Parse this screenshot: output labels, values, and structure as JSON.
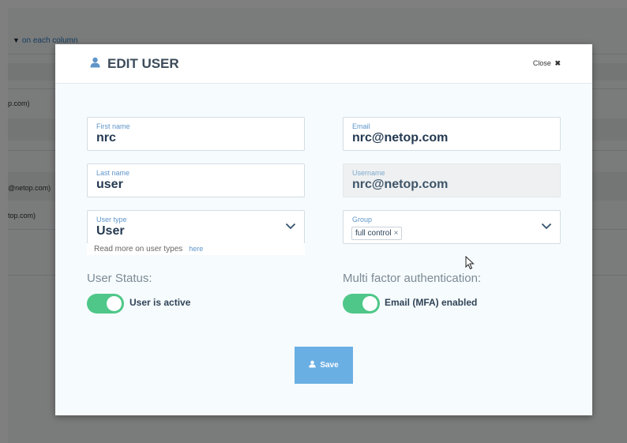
{
  "background": {
    "filter_hint_prefix": "▼",
    "filter_hint": "on each column",
    "row_fragments": [
      "p.com)",
      "@netop.com)",
      "top.com)"
    ]
  },
  "modal": {
    "title": "EDIT USER",
    "close_label": "Close",
    "close_symbol": "✖",
    "fields": {
      "first_name": {
        "label": "First name",
        "value": "nrc"
      },
      "email": {
        "label": "Email",
        "value": "nrc@netop.com"
      },
      "last_name": {
        "label": "Last name",
        "value": "user"
      },
      "username": {
        "label": "Username",
        "value": "nrc@netop.com"
      },
      "user_type": {
        "label": "User type",
        "value": "User"
      },
      "group": {
        "label": "Group",
        "tags": [
          {
            "label": "full control",
            "remove": "×"
          }
        ]
      }
    },
    "user_type_hint": {
      "text": "Read more on user types",
      "link": "here"
    },
    "user_status": {
      "title": "User Status:",
      "toggle_label": "User is active",
      "on": true
    },
    "mfa": {
      "title": "Multi factor authentication:",
      "toggle_label": "Email (MFA) enabled",
      "on": true
    },
    "save_label": "Save"
  },
  "colors": {
    "accent": "#5e95c9",
    "toggle_on": "#4ec788",
    "save_button": "#6aafe3",
    "title_text": "#3c4b5a"
  },
  "icons": [
    "user-icon",
    "close-icon",
    "chevron-down-icon",
    "funnel-icon",
    "mouse-cursor-icon"
  ]
}
